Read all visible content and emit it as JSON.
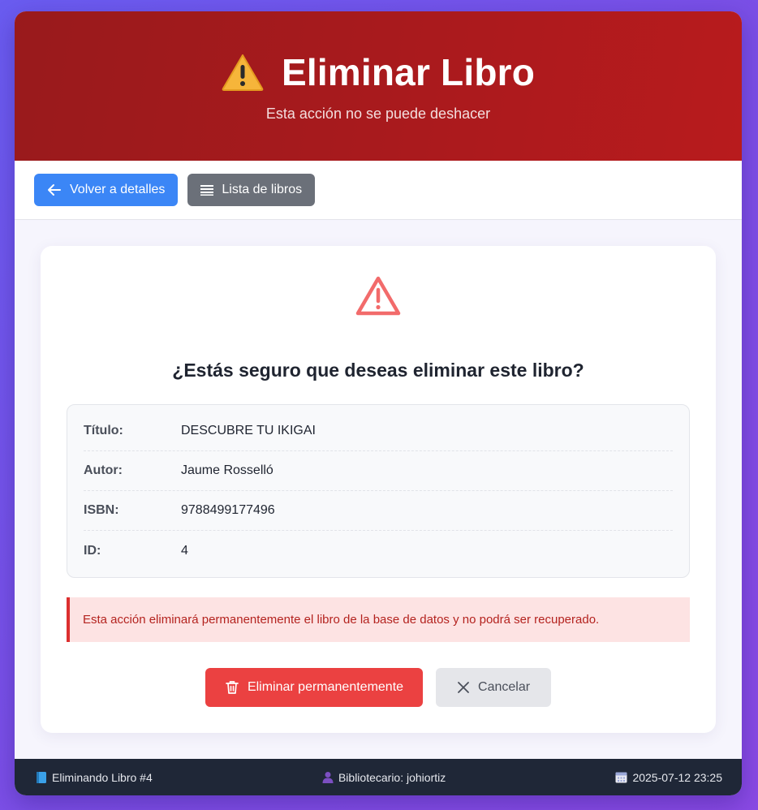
{
  "header": {
    "title": "Eliminar Libro",
    "subtitle": "Esta acción no se puede deshacer"
  },
  "toolbar": {
    "back_label": "Volver a detalles",
    "list_label": "Lista de libros"
  },
  "card": {
    "question": "¿Estás seguro que deseas eliminar este libro?",
    "fields": [
      {
        "label": "Título:",
        "value": "DESCUBRE TU IKIGAI"
      },
      {
        "label": "Autor:",
        "value": "Jaume Rosselló"
      },
      {
        "label": "ISBN:",
        "value": "9788499177496"
      },
      {
        "label": "ID:",
        "value": "4"
      }
    ],
    "alert": "Esta acción eliminará permanentemente el libro de la base de datos y no podrá ser recuperado.",
    "delete_label": "Eliminar permanentemente",
    "cancel_label": "Cancelar"
  },
  "footer": {
    "left": "Eliminando Libro #4",
    "center": "Bibliotecario: johiortiz",
    "right": "2025-07-12 23:25"
  },
  "colors": {
    "header": "#a81a1d",
    "primary": "#3b86f6",
    "secondary": "#6b7079",
    "danger": "#eb4141",
    "footer": "#1f2737"
  },
  "icons": {
    "title": "warning-emoji-icon",
    "back": "arrow-left-icon",
    "list": "list-icon",
    "card": "warning-triangle-icon",
    "delete": "trash-icon",
    "cancel": "close-icon",
    "footer_left": "book-icon",
    "footer_center": "user-icon",
    "footer_right": "calendar-icon"
  }
}
